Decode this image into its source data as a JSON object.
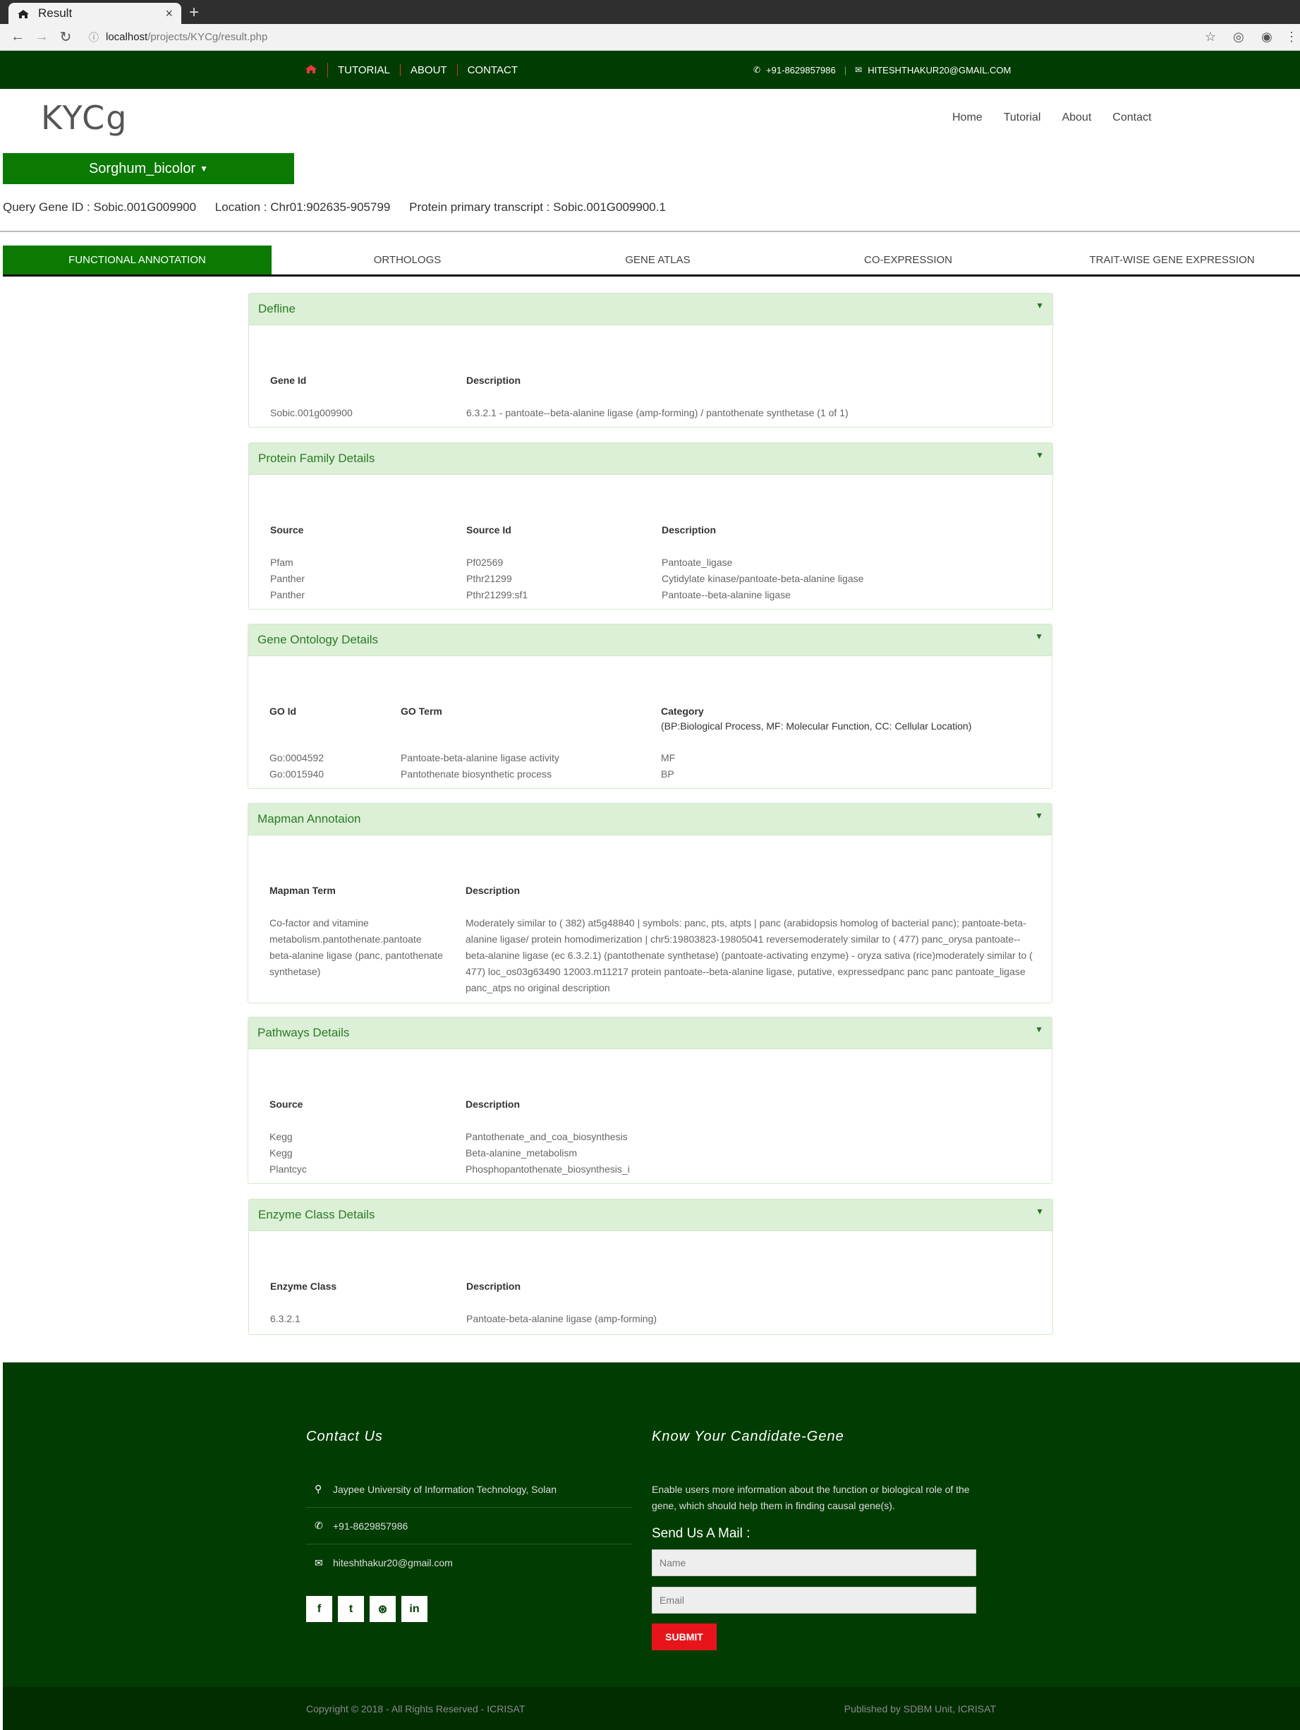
{
  "browser": {
    "tab_title": "Result",
    "new_tab": "+",
    "url_host": "localhost",
    "url_path": "/projects/KYCg/result.php"
  },
  "topbar": {
    "nav": [
      "TUTORIAL",
      "ABOUT",
      "CONTACT"
    ],
    "phone": "+91-8629857986",
    "email": "HITESHTHAKUR20@GMAIL.COM"
  },
  "header": {
    "logo": "KYCg",
    "nav": [
      "Home",
      "Tutorial",
      "About",
      "Contact"
    ],
    "species": "Sorghum_bicolor"
  },
  "query": {
    "gene": "Query Gene ID : Sobic.001G009900",
    "location": "Location : Chr01:902635-905799",
    "transcript": "Protein primary transcript : Sobic.001G009900.1"
  },
  "tabs": [
    "FUNCTIONAL ANNOTATION",
    "ORTHOLOGS",
    "GENE ATLAS",
    "CO-EXPRESSION",
    "TRAIT-WISE GENE EXPRESSION"
  ],
  "defline": {
    "title": "Defline",
    "headers": [
      "Gene Id",
      "Description"
    ],
    "rows": [
      [
        "Sobic.001g009900",
        "6.3.2.1 - pantoate--beta-alanine ligase (amp-forming) / pantothenate synthetase (1 of 1)"
      ]
    ]
  },
  "protein_family": {
    "title": "Protein Family Details",
    "headers": [
      "Source",
      "Source Id",
      "Description"
    ],
    "rows": [
      [
        "Pfam",
        "Pf02569",
        "Pantoate_ligase"
      ],
      [
        "Panther",
        "Pthr21299",
        "Cytidylate kinase/pantoate-beta-alanine ligase"
      ],
      [
        "Panther",
        "Pthr21299:sf1",
        "Pantoate--beta-alanine ligase"
      ]
    ]
  },
  "gene_ontology": {
    "title": "Gene Ontology Details",
    "headers": [
      "GO Id",
      "GO Term",
      "Category"
    ],
    "category_note": "(BP:Biological Process, MF: Molecular Function, CC: Cellular Location)",
    "rows": [
      [
        "Go:0004592",
        "Pantoate-beta-alanine ligase activity",
        "MF"
      ],
      [
        "Go:0015940",
        "Pantothenate biosynthetic process",
        "BP"
      ]
    ]
  },
  "mapman": {
    "title": "Mapman Annotaion",
    "headers": [
      "Mapman Term",
      "Description"
    ],
    "term": "Co-factor and vitamine metabolism.pantothenate.pantoate beta-alanine ligase (panc, pantothenate synthetase)",
    "description": "Moderately similar to ( 382) at5g48840 | symbols: panc, pts, atpts | panc (arabidopsis homolog of bacterial panc); pantoate-beta-alanine ligase/ protein homodimerization | chr5:19803823-19805041 reversemoderately similar to ( 477) panc_orysa pantoate--beta-alanine ligase (ec 6.3.2.1) (pantothenate synthetase) (pantoate-activating enzyme) - oryza sativa (rice)moderately similar to ( 477) loc_os03g63490 12003.m11217 protein pantoate--beta-alanine ligase, putative, expressedpanc panc panc pantoate_ligase panc_atps no original description"
  },
  "pathways": {
    "title": "Pathways Details",
    "headers": [
      "Source",
      "Description"
    ],
    "rows": [
      [
        "Kegg",
        "Pantothenate_and_coa_biosynthesis"
      ],
      [
        "Kegg",
        "Beta-alanine_metabolism"
      ],
      [
        "Plantcyc",
        "Phosphopantothenate_biosynthesis_i"
      ]
    ]
  },
  "enzyme": {
    "title": "Enzyme Class Details",
    "headers": [
      "Enzyme Class",
      "Description"
    ],
    "rows": [
      [
        "6.3.2.1",
        "Pantoate-beta-alanine ligase (amp-forming)"
      ]
    ]
  },
  "footer": {
    "contact_title": "Contact Us",
    "address": "Jaypee University of Information Technology, Solan",
    "phone": "+91-8629857986",
    "email": "hiteshthakur20@gmail.com",
    "kycg_title": "Know Your Candidate-Gene",
    "kycg_desc": "Enable users more information about the function or biological role of the gene, which should help them in finding causal gene(s).",
    "mail_title": "Send Us A Mail :",
    "name_placeholder": "Name",
    "email_placeholder": "Email",
    "submit": "SUBMIT",
    "copyright": "Copyright © 2018 - All Rights Reserved - ICRISAT",
    "published": "Published by SDBM Unit, ICRISAT"
  }
}
